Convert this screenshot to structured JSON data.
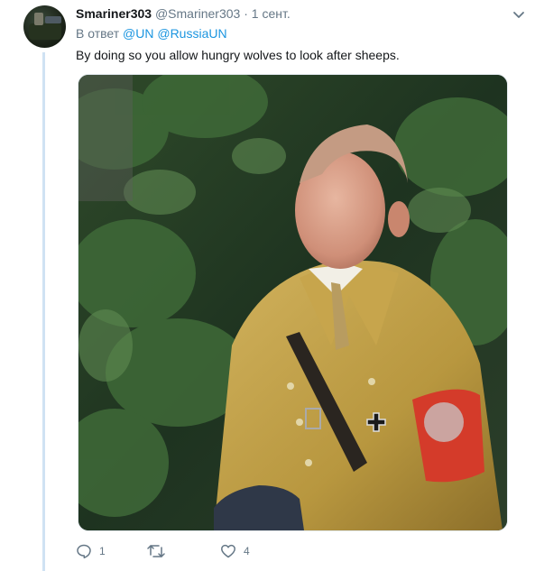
{
  "tweet": {
    "author": {
      "display_name": "Smariner303",
      "handle": "@Smariner303",
      "separator": "·",
      "date": "1 сент."
    },
    "reply": {
      "prefix": "В ответ",
      "mentions": [
        "@UN",
        "@RussiaUN"
      ]
    },
    "text": "By doing so you allow hungry wolves to look after sheeps.",
    "actions": {
      "reply_count": "1",
      "retweet_count": "",
      "like_count": "4"
    }
  },
  "colors": {
    "link": "#1b95e0",
    "muted": "#657786",
    "thread_line": "#cfe2f3"
  },
  "icons": [
    "more-options-chevron-icon",
    "reply-icon",
    "retweet-icon",
    "like-icon"
  ]
}
